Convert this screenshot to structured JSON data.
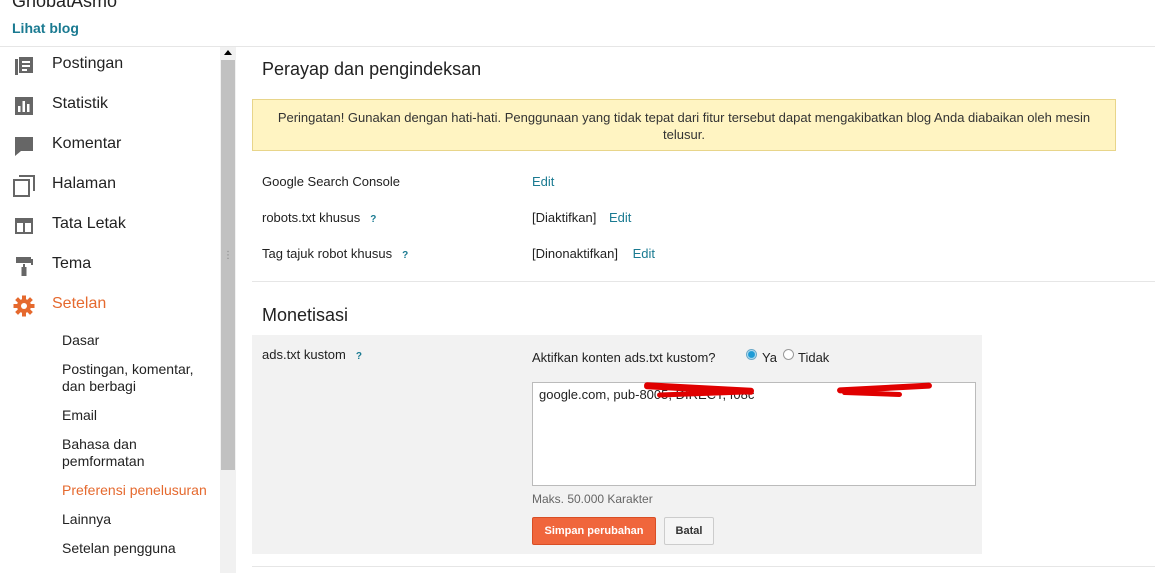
{
  "header": {
    "blog_name": "GhobatAsmo",
    "view_blog": "Lihat blog"
  },
  "sidebar": {
    "items": [
      {
        "label": "Postingan",
        "icon": "posts-icon"
      },
      {
        "label": "Statistik",
        "icon": "stats-icon"
      },
      {
        "label": "Komentar",
        "icon": "comment-icon"
      },
      {
        "label": "Halaman",
        "icon": "pages-icon"
      },
      {
        "label": "Tata Letak",
        "icon": "layout-icon"
      },
      {
        "label": "Tema",
        "icon": "paint-roller-icon"
      },
      {
        "label": "Setelan",
        "icon": "gear-icon",
        "active": true
      }
    ],
    "sub_items": [
      {
        "label": "Dasar"
      },
      {
        "label": "Postingan, komentar, dan berbagi"
      },
      {
        "label": "Email"
      },
      {
        "label": "Bahasa dan pemformatan"
      },
      {
        "label": "Preferensi penelusuran",
        "active": true
      },
      {
        "label": "Lainnya"
      },
      {
        "label": "Setelan pengguna"
      }
    ]
  },
  "crawling": {
    "title": "Perayap dan pengindeksan",
    "warning": "Peringatan! Gunakan dengan hati-hati. Penggunaan yang tidak tepat dari fitur tersebut dapat mengakibatkan blog Anda diabaikan oleh mesin telusur.",
    "rows": [
      {
        "label": "Google Search Console",
        "status": "",
        "edit": "Edit"
      },
      {
        "label": "robots.txt khusus",
        "help": "?",
        "status": "[Diaktifkan]",
        "edit": "Edit"
      },
      {
        "label": "Tag tajuk robot khusus",
        "help": "?",
        "status": "[Dinonaktifkan]",
        "edit": "Edit"
      }
    ]
  },
  "monetization": {
    "title": "Monetisasi",
    "ads_label": "ads.txt kustom",
    "ads_help": "?",
    "question": "Aktifkan konten ads.txt kustom?",
    "option_yes": "Ya",
    "option_no": "Tidak",
    "selected": "Ya",
    "ads_content": "google.com, pub-8005, DIRECT, f08c",
    "max_chars": "Maks. 50.000 Karakter",
    "save_label": "Simpan perubahan",
    "cancel_label": "Batal"
  },
  "colors": {
    "accent": "#e5692e",
    "link": "#1a7a91",
    "warning_bg": "#fff4c2",
    "save_bg": "#f0663c"
  }
}
